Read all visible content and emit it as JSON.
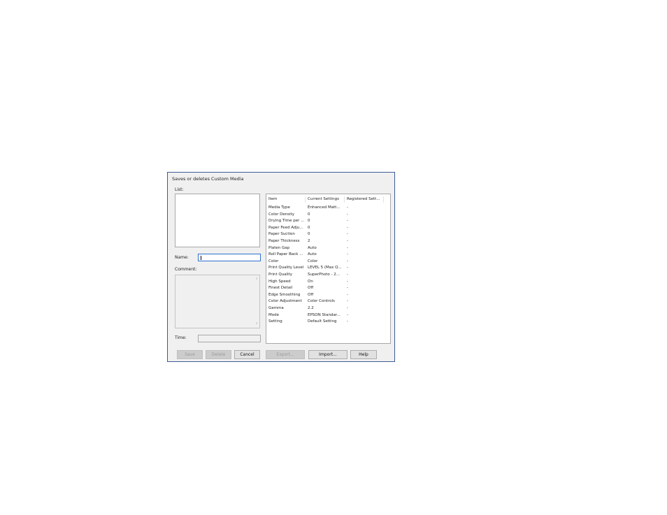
{
  "dialog": {
    "title": "Saves or deletes Custom Media",
    "list_label": "List:",
    "name_label": "Name:",
    "name_value": "",
    "comment_label": "Comment:",
    "time_label": "Time:",
    "time_value": ""
  },
  "settings_table": {
    "headers": {
      "item": "Item",
      "current": "Current Settings",
      "registered": "Registered Sett..."
    },
    "rows": [
      {
        "item": "Media Type",
        "current": "Enhanced Matt...",
        "registered": "-"
      },
      {
        "item": "Color Density",
        "current": "0",
        "registered": "-"
      },
      {
        "item": "Drying Time per ...",
        "current": "0",
        "registered": "-"
      },
      {
        "item": "Paper Feed Adju...",
        "current": "0",
        "registered": "-"
      },
      {
        "item": "Paper Suction",
        "current": "0",
        "registered": "-"
      },
      {
        "item": "Paper Thickness",
        "current": "2",
        "registered": "-"
      },
      {
        "item": "Platen Gap",
        "current": "Auto",
        "registered": "-"
      },
      {
        "item": "Roll Paper Back ...",
        "current": "Auto",
        "registered": "-"
      },
      {
        "item": "Color",
        "current": "Color",
        "registered": "-"
      },
      {
        "item": "Print Quality Level",
        "current": "LEVEL 5 (Max Q...",
        "registered": "-"
      },
      {
        "item": "Print Quality",
        "current": "SuperPhoto - 2...",
        "registered": "-"
      },
      {
        "item": "High Speed",
        "current": "On",
        "registered": "-"
      },
      {
        "item": "Finest Detail",
        "current": "Off",
        "registered": "-"
      },
      {
        "item": "Edge Smoothing",
        "current": "Off",
        "registered": "-"
      },
      {
        "item": "Color Adjustment",
        "current": "Color Controls",
        "registered": "-"
      },
      {
        "item": "Gamma",
        "current": "2.2",
        "registered": "-"
      },
      {
        "item": "Mode",
        "current": "EPSON Standar...",
        "registered": "-"
      },
      {
        "item": "Setting",
        "current": "Default Setting",
        "registered": "-"
      }
    ]
  },
  "buttons": {
    "save": "Save",
    "delete": "Delete",
    "cancel": "Cancel",
    "export": "Export...",
    "import": "Import...",
    "help": "Help"
  }
}
